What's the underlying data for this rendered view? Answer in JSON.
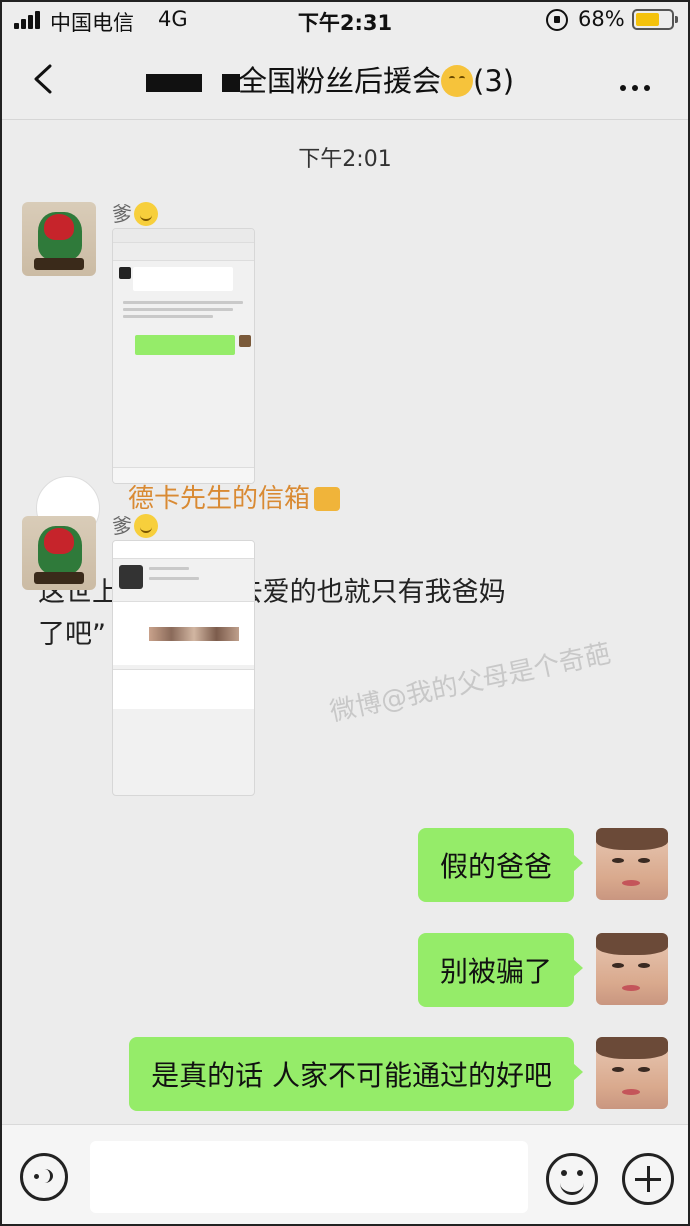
{
  "status_bar": {
    "carrier": "中国电信",
    "network": "4G",
    "time": "下午2:31",
    "battery_percent": "68%",
    "battery_level": 0.68,
    "battery_color": "#f4c20d"
  },
  "header": {
    "title": "全国粉丝后援会",
    "member_count": "(3)",
    "back_icon": "chevron-left-icon",
    "more_icon": "more-dots-icon"
  },
  "chat": {
    "timestamp": "下午2:01",
    "incoming": [
      {
        "sender": "爹",
        "type": "image-screenshot"
      },
      {
        "sender": "爹",
        "type": "image-screenshot"
      }
    ],
    "overlay": {
      "title": "德卡先生的信箱",
      "quote_line1": "这世上     放心大胆去爱的也就只有我爸妈",
      "quote_line2": "了吧”"
    },
    "watermark": "微博@我的父母是个奇葩",
    "outgoing": [
      {
        "text": "假的爸爸"
      },
      {
        "text": "别被骗了"
      },
      {
        "text": "是真的话 人家不可能通过的好吧"
      }
    ],
    "bubble_color": "#95ec69"
  },
  "input_bar": {
    "placeholder": "",
    "voice_icon": "voice-icon",
    "emoji_icon": "emoji-icon",
    "plus_icon": "plus-icon"
  }
}
